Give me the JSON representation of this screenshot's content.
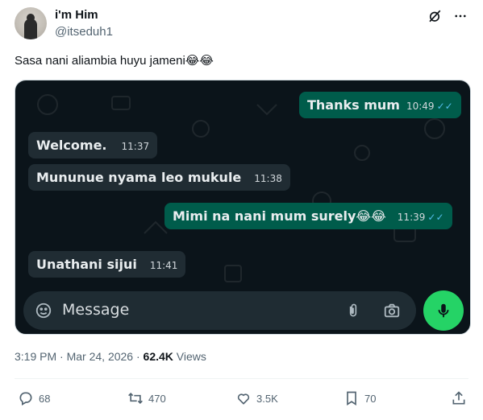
{
  "author": {
    "display_name": "i'm Him",
    "handle": "@itseduh1"
  },
  "tweet": {
    "text": "Sasa nani aliambia huyu jameni😂😂"
  },
  "chat": {
    "messages": [
      {
        "direction": "out",
        "text": "Thanks mum",
        "time": "10:49",
        "ticks": "✓✓"
      },
      {
        "direction": "in",
        "text": "Welcome.",
        "time": "11:37"
      },
      {
        "direction": "in",
        "text": "Mununue nyama leo mukule",
        "time": "11:38"
      },
      {
        "direction": "out",
        "text": "Mimi na nani mum surely😂😂",
        "time": "11:39",
        "ticks": "✓✓"
      },
      {
        "direction": "in",
        "text": "Unathani sijui",
        "time": "11:41"
      }
    ],
    "input_placeholder": "Message",
    "colors": {
      "background": "#0b141a",
      "incoming": "#202c33",
      "outgoing": "#005c4b",
      "mic": "#25d366"
    }
  },
  "meta": {
    "time": "3:19 PM",
    "sep": " · ",
    "date": "Mar 24, 2026",
    "sep2": " · ",
    "views_count": "62.4K",
    "views_label": " Views"
  },
  "actions": {
    "replies": "68",
    "reposts": "470",
    "likes": "3.5K",
    "bookmarks": "70"
  },
  "icons": [
    "grok-icon",
    "more-icon",
    "sticker-icon",
    "attach-icon",
    "camera-icon",
    "mic-icon",
    "reply-icon",
    "repost-icon",
    "like-icon",
    "bookmark-icon",
    "share-icon"
  ]
}
